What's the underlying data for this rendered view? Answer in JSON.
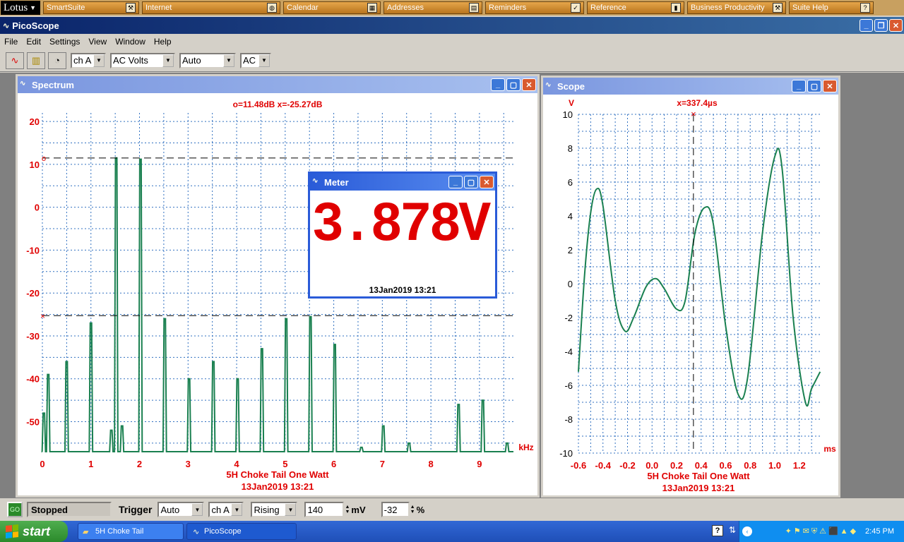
{
  "lotus_bar": {
    "logo": "Lotus",
    "items": [
      {
        "label": "SmartSuite",
        "icon": "tools-icon"
      },
      {
        "label": "Internet",
        "icon": "globe-icon"
      },
      {
        "label": "Calendar",
        "icon": "calendar-icon"
      },
      {
        "label": "Addresses",
        "icon": "address-card-icon"
      },
      {
        "label": "Reminders",
        "icon": "checkmark-icon"
      },
      {
        "label": "Reference",
        "icon": "book-icon"
      },
      {
        "label": "Business Productivity",
        "icon": "tools-icon"
      },
      {
        "label": "Suite Help",
        "icon": "help-icon"
      }
    ]
  },
  "app": {
    "title": "PicoScope"
  },
  "menu": [
    "File",
    "Edit",
    "Settings",
    "View",
    "Window",
    "Help"
  ],
  "toolbar": {
    "channel": "ch A",
    "mode": "AC Volts",
    "range": "Auto",
    "coupling": "AC"
  },
  "spectrum": {
    "title": "Spectrum",
    "readout": "o=11.48dB  x=-25.27dB",
    "caption": "5H Choke Tail One Watt",
    "date": "13Jan2019  13:21",
    "marker_o": "o",
    "marker_x": "×"
  },
  "meter": {
    "title": "Meter",
    "value": "3.878V",
    "date": "13Jan2019  13:21"
  },
  "scope": {
    "title": "Scope",
    "readout": "x=337.4µs",
    "caption": "5H Choke Tail One Watt",
    "date": "13Jan2019  13:21",
    "marker_x": "×"
  },
  "chart_data": [
    {
      "type": "line",
      "name": "spectrum",
      "xlabel": "kHz",
      "ylabel": "",
      "xlim": [
        0,
        9.7
      ],
      "ylim": [
        -57,
        22
      ],
      "x_ticks": [
        "0",
        "1",
        "2",
        "3",
        "4",
        "5",
        "6",
        "7",
        "8",
        "9"
      ],
      "y_ticks": [
        "20",
        "10",
        "0",
        "-10",
        "-20",
        "-30",
        "-40",
        "-50"
      ],
      "grid": true,
      "cursors": {
        "o": 11.48,
        "x": -25.27
      },
      "peaks": [
        {
          "x": 0.03,
          "y": -48
        },
        {
          "x": 0.12,
          "y": -39
        },
        {
          "x": 0.5,
          "y": -36
        },
        {
          "x": 1.0,
          "y": -27
        },
        {
          "x": 1.42,
          "y": -52
        },
        {
          "x": 1.52,
          "y": 11.5
        },
        {
          "x": 1.64,
          "y": -51
        },
        {
          "x": 2.02,
          "y": 11.2
        },
        {
          "x": 2.52,
          "y": -26
        },
        {
          "x": 3.02,
          "y": -40
        },
        {
          "x": 3.52,
          "y": -36
        },
        {
          "x": 4.02,
          "y": -40
        },
        {
          "x": 4.52,
          "y": -33
        },
        {
          "x": 5.02,
          "y": -26
        },
        {
          "x": 5.52,
          "y": -25.5
        },
        {
          "x": 6.02,
          "y": -32
        },
        {
          "x": 6.57,
          "y": -56
        },
        {
          "x": 7.02,
          "y": -51
        },
        {
          "x": 7.55,
          "y": -55
        },
        {
          "x": 8.57,
          "y": -46
        },
        {
          "x": 9.07,
          "y": -45
        },
        {
          "x": 9.57,
          "y": -55
        }
      ]
    },
    {
      "type": "line",
      "name": "scope",
      "xlabel": "ms",
      "ylabel": "V",
      "xlim": [
        -0.6,
        1.38
      ],
      "ylim": [
        -10,
        10
      ],
      "x_ticks": [
        "-0.6",
        "-0.4",
        "-0.2",
        "0.0",
        "0.2",
        "0.4",
        "0.6",
        "0.8",
        "1.0",
        "1.2"
      ],
      "y_ticks": [
        "10",
        "8",
        "6",
        "4",
        "2",
        "0",
        "-2",
        "-4",
        "-6",
        "-8",
        "-10"
      ],
      "grid": true,
      "cursor_x": 0.3374,
      "points": [
        {
          "x": -0.6,
          "y": -5.2
        },
        {
          "x": -0.55,
          "y": 0.5
        },
        {
          "x": -0.5,
          "y": 4.2
        },
        {
          "x": -0.45,
          "y": 5.6
        },
        {
          "x": -0.4,
          "y": 4.6
        },
        {
          "x": -0.3,
          "y": -1.0
        },
        {
          "x": -0.22,
          "y": -2.8
        },
        {
          "x": -0.15,
          "y": -2.0
        },
        {
          "x": -0.05,
          "y": -0.2
        },
        {
          "x": 0.03,
          "y": 0.3
        },
        {
          "x": 0.1,
          "y": -0.3
        },
        {
          "x": 0.2,
          "y": -1.5
        },
        {
          "x": 0.27,
          "y": -1.0
        },
        {
          "x": 0.35,
          "y": 3.0
        },
        {
          "x": 0.43,
          "y": 4.5
        },
        {
          "x": 0.5,
          "y": 3.5
        },
        {
          "x": 0.6,
          "y": -2.5
        },
        {
          "x": 0.7,
          "y": -6.5
        },
        {
          "x": 0.78,
          "y": -5.5
        },
        {
          "x": 0.9,
          "y": 3.0
        },
        {
          "x": 1.0,
          "y": 7.5
        },
        {
          "x": 1.06,
          "y": 6.8
        },
        {
          "x": 1.15,
          "y": -2.0
        },
        {
          "x": 1.25,
          "y": -7.0
        },
        {
          "x": 1.3,
          "y": -6.2
        },
        {
          "x": 1.37,
          "y": -5.2
        }
      ]
    }
  ],
  "status": {
    "led": "GO",
    "state": "Stopped",
    "trigger_label": "Trigger",
    "trigger_mode": "Auto",
    "trigger_channel": "ch A",
    "trigger_edge": "Rising",
    "level": "140",
    "level_unit": "mV",
    "delay": "-32",
    "delay_unit": "%"
  },
  "taskbar": {
    "start": "start",
    "tasks": [
      "5H Choke Tail",
      "PicoScope"
    ],
    "clock": "2:45 PM",
    "colors": {
      "start": "#3a9a3a",
      "bar": "#245edb"
    }
  },
  "colors": {
    "trace": "#1a8050",
    "text_red": "#e00000",
    "grid": "#3070c0"
  }
}
